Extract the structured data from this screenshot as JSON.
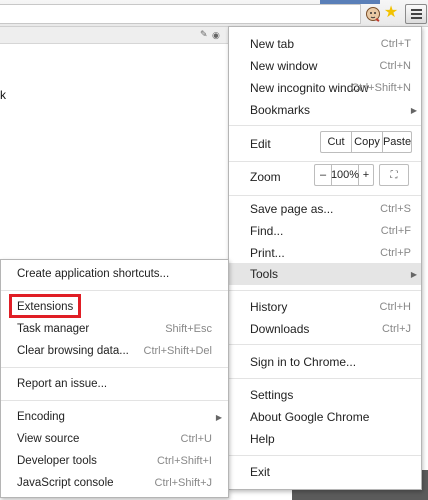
{
  "toolbar": {
    "icons": [
      "extension-dog-icon",
      "bookmark-star-icon",
      "chrome-menu-icon"
    ],
    "star_color": "#f2c200"
  },
  "page": {
    "partial_text": "k"
  },
  "menu": {
    "new_tab": {
      "label": "New tab",
      "shortcut": "Ctrl+T"
    },
    "new_window": {
      "label": "New window",
      "shortcut": "Ctrl+N"
    },
    "new_incognito": {
      "label": "New incognito window",
      "shortcut": "Ctrl+Shift+N"
    },
    "bookmarks": {
      "label": "Bookmarks"
    },
    "edit": {
      "label": "Edit",
      "cut": "Cut",
      "copy": "Copy",
      "paste": "Paste"
    },
    "zoom": {
      "label": "Zoom",
      "minus": "–",
      "value": "100%",
      "plus": "+"
    },
    "save_page": {
      "label": "Save page as...",
      "shortcut": "Ctrl+S"
    },
    "find": {
      "label": "Find...",
      "shortcut": "Ctrl+F"
    },
    "print": {
      "label": "Print...",
      "shortcut": "Ctrl+P"
    },
    "tools": {
      "label": "Tools"
    },
    "history": {
      "label": "History",
      "shortcut": "Ctrl+H"
    },
    "downloads": {
      "label": "Downloads",
      "shortcut": "Ctrl+J"
    },
    "sign_in": {
      "label": "Sign in to Chrome..."
    },
    "settings": {
      "label": "Settings"
    },
    "about": {
      "label": "About Google Chrome"
    },
    "help": {
      "label": "Help"
    },
    "exit": {
      "label": "Exit"
    }
  },
  "submenu": {
    "create_shortcuts": {
      "label": "Create application shortcuts..."
    },
    "extensions": {
      "label": "Extensions"
    },
    "task_manager": {
      "label": "Task manager",
      "shortcut": "Shift+Esc"
    },
    "clear_data": {
      "label": "Clear browsing data...",
      "shortcut": "Ctrl+Shift+Del"
    },
    "report_issue": {
      "label": "Report an issue..."
    },
    "encoding": {
      "label": "Encoding"
    },
    "view_source": {
      "label": "View source",
      "shortcut": "Ctrl+U"
    },
    "developer_tools": {
      "label": "Developer tools",
      "shortcut": "Ctrl+Shift+I"
    },
    "js_console": {
      "label": "JavaScript console",
      "shortcut": "Ctrl+Shift+J"
    }
  },
  "colors": {
    "highlight_border": "#e01e25",
    "hover_row": "#e5e5e5"
  }
}
